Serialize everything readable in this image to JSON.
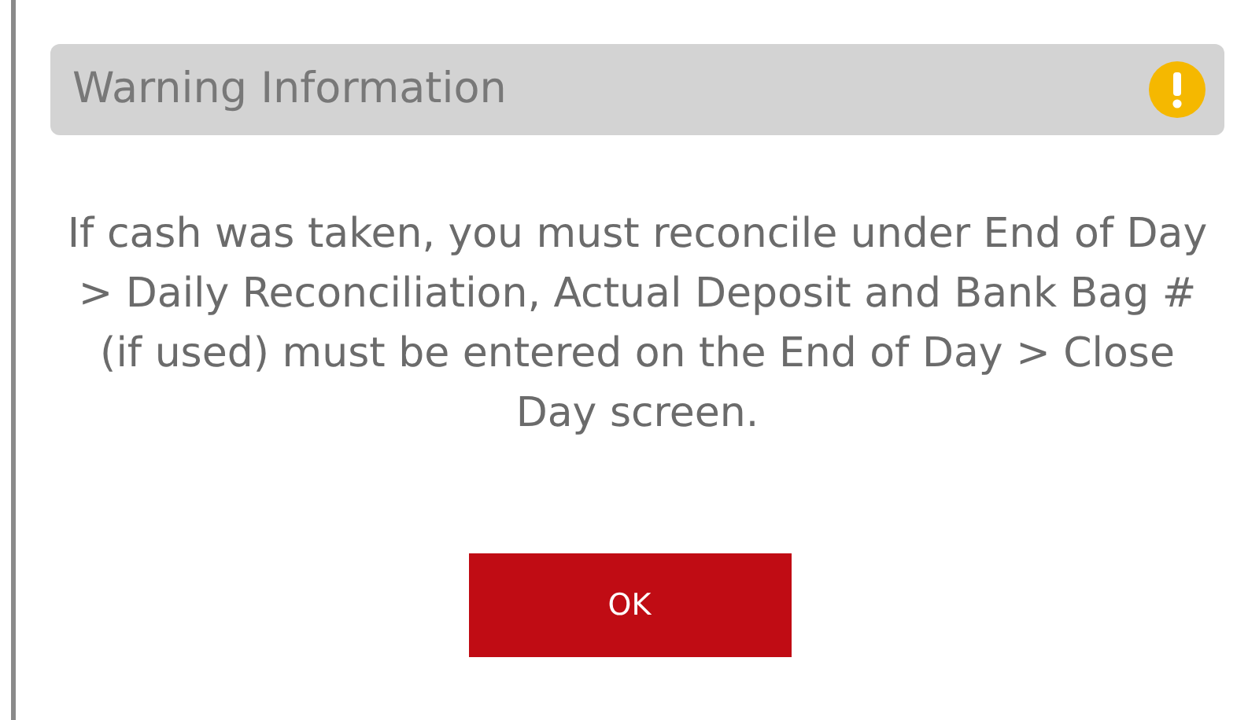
{
  "dialog": {
    "title": "Warning Information",
    "message": "If cash was taken, you must reconcile under End of Day > Daily Reconciliation, Actual Deposit and Bank Bag # (if used) must be entered on the End of Day > Close Day screen.",
    "buttons": [
      "OK"
    ]
  }
}
